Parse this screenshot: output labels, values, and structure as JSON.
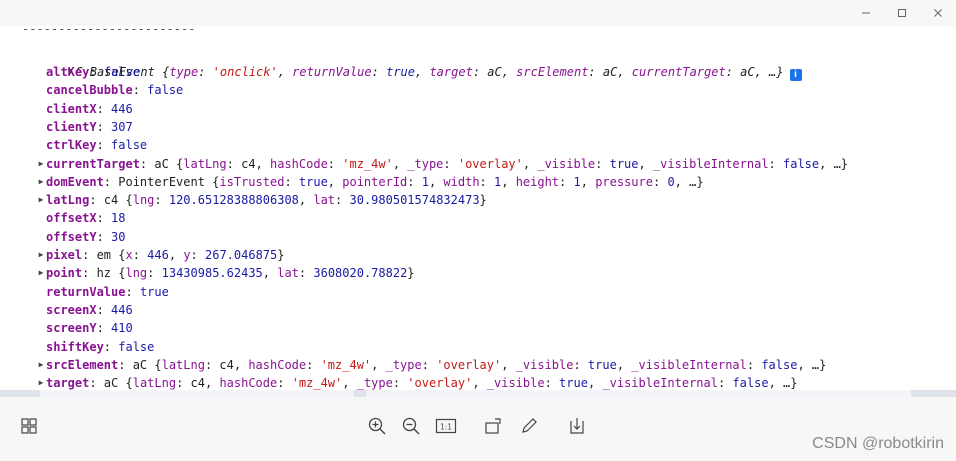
{
  "window": {
    "controls": {
      "minimize": "—",
      "maximize": "□",
      "close": "✕"
    }
  },
  "console": {
    "separator": "------------------------",
    "header": {
      "class_name": "C.BaseEvent",
      "summary_parts": [
        {
          "t": "{",
          "c": "punc"
        },
        {
          "t": "type",
          "c": "knb"
        },
        {
          "t": ": ",
          "c": "punc"
        },
        {
          "t": "'onclick'",
          "c": "str"
        },
        {
          "t": ", ",
          "c": "punc"
        },
        {
          "t": "returnValue",
          "c": "knb"
        },
        {
          "t": ": ",
          "c": "punc"
        },
        {
          "t": "true",
          "c": "bool"
        },
        {
          "t": ", ",
          "c": "punc"
        },
        {
          "t": "target",
          "c": "knb"
        },
        {
          "t": ": aC, ",
          "c": "punc"
        },
        {
          "t": "srcElement",
          "c": "knb"
        },
        {
          "t": ": aC, ",
          "c": "punc"
        },
        {
          "t": "currentTarget",
          "c": "knb"
        },
        {
          "t": ": aC, …}",
          "c": "punc"
        }
      ],
      "info_icon": "i"
    },
    "properties": [
      {
        "key": "altKey",
        "expandable": false,
        "parts": [
          {
            "t": "false",
            "c": "bool"
          }
        ]
      },
      {
        "key": "cancelBubble",
        "expandable": false,
        "parts": [
          {
            "t": "false",
            "c": "bool"
          }
        ]
      },
      {
        "key": "clientX",
        "expandable": false,
        "parts": [
          {
            "t": "446",
            "c": "num"
          }
        ]
      },
      {
        "key": "clientY",
        "expandable": false,
        "parts": [
          {
            "t": "307",
            "c": "num"
          }
        ]
      },
      {
        "key": "ctrlKey",
        "expandable": false,
        "parts": [
          {
            "t": "false",
            "c": "bool"
          }
        ]
      },
      {
        "key": "currentTarget",
        "expandable": true,
        "parts": [
          {
            "t": "aC {",
            "c": "obj"
          },
          {
            "t": "latLng",
            "c": "knb"
          },
          {
            "t": ": c4, ",
            "c": "obj"
          },
          {
            "t": "hashCode",
            "c": "knb"
          },
          {
            "t": ": ",
            "c": "obj"
          },
          {
            "t": "'mz_4w'",
            "c": "str"
          },
          {
            "t": ", ",
            "c": "obj"
          },
          {
            "t": "_type",
            "c": "knb"
          },
          {
            "t": ": ",
            "c": "obj"
          },
          {
            "t": "'overlay'",
            "c": "str"
          },
          {
            "t": ", ",
            "c": "obj"
          },
          {
            "t": "_visible",
            "c": "knb"
          },
          {
            "t": ": ",
            "c": "obj"
          },
          {
            "t": "true",
            "c": "bool"
          },
          {
            "t": ", ",
            "c": "obj"
          },
          {
            "t": "_visibleInternal",
            "c": "knb"
          },
          {
            "t": ": ",
            "c": "obj"
          },
          {
            "t": "false",
            "c": "bool"
          },
          {
            "t": ", …}",
            "c": "obj"
          }
        ]
      },
      {
        "key": "domEvent",
        "expandable": true,
        "parts": [
          {
            "t": "PointerEvent {",
            "c": "obj"
          },
          {
            "t": "isTrusted",
            "c": "knb"
          },
          {
            "t": ": ",
            "c": "obj"
          },
          {
            "t": "true",
            "c": "bool"
          },
          {
            "t": ", ",
            "c": "obj"
          },
          {
            "t": "pointerId",
            "c": "knb"
          },
          {
            "t": ": ",
            "c": "obj"
          },
          {
            "t": "1",
            "c": "num"
          },
          {
            "t": ", ",
            "c": "obj"
          },
          {
            "t": "width",
            "c": "knb"
          },
          {
            "t": ": ",
            "c": "obj"
          },
          {
            "t": "1",
            "c": "num"
          },
          {
            "t": ", ",
            "c": "obj"
          },
          {
            "t": "height",
            "c": "knb"
          },
          {
            "t": ": ",
            "c": "obj"
          },
          {
            "t": "1",
            "c": "num"
          },
          {
            "t": ", ",
            "c": "obj"
          },
          {
            "t": "pressure",
            "c": "knb"
          },
          {
            "t": ": ",
            "c": "obj"
          },
          {
            "t": "0",
            "c": "num"
          },
          {
            "t": ", …}",
            "c": "obj"
          }
        ]
      },
      {
        "key": "latLng",
        "expandable": true,
        "parts": [
          {
            "t": "c4 {",
            "c": "obj"
          },
          {
            "t": "lng",
            "c": "knb"
          },
          {
            "t": ": ",
            "c": "obj"
          },
          {
            "t": "120.65128388806308",
            "c": "num"
          },
          {
            "t": ", ",
            "c": "obj"
          },
          {
            "t": "lat",
            "c": "knb"
          },
          {
            "t": ": ",
            "c": "obj"
          },
          {
            "t": "30.980501574832473",
            "c": "num"
          },
          {
            "t": "}",
            "c": "obj"
          }
        ]
      },
      {
        "key": "offsetX",
        "expandable": false,
        "parts": [
          {
            "t": "18",
            "c": "num"
          }
        ]
      },
      {
        "key": "offsetY",
        "expandable": false,
        "parts": [
          {
            "t": "30",
            "c": "num"
          }
        ]
      },
      {
        "key": "pixel",
        "expandable": true,
        "parts": [
          {
            "t": "em {",
            "c": "obj"
          },
          {
            "t": "x",
            "c": "knb"
          },
          {
            "t": ": ",
            "c": "obj"
          },
          {
            "t": "446",
            "c": "num"
          },
          {
            "t": ", ",
            "c": "obj"
          },
          {
            "t": "y",
            "c": "knb"
          },
          {
            "t": ": ",
            "c": "obj"
          },
          {
            "t": "267.046875",
            "c": "num"
          },
          {
            "t": "}",
            "c": "obj"
          }
        ]
      },
      {
        "key": "point",
        "expandable": true,
        "parts": [
          {
            "t": "hz {",
            "c": "obj"
          },
          {
            "t": "lng",
            "c": "knb"
          },
          {
            "t": ": ",
            "c": "obj"
          },
          {
            "t": "13430985.62435",
            "c": "num"
          },
          {
            "t": ", ",
            "c": "obj"
          },
          {
            "t": "lat",
            "c": "knb"
          },
          {
            "t": ": ",
            "c": "obj"
          },
          {
            "t": "3608020.78822",
            "c": "num"
          },
          {
            "t": "}",
            "c": "obj"
          }
        ]
      },
      {
        "key": "returnValue",
        "expandable": false,
        "parts": [
          {
            "t": "true",
            "c": "bool"
          }
        ]
      },
      {
        "key": "screenX",
        "expandable": false,
        "parts": [
          {
            "t": "446",
            "c": "num"
          }
        ]
      },
      {
        "key": "screenY",
        "expandable": false,
        "parts": [
          {
            "t": "410",
            "c": "num"
          }
        ]
      },
      {
        "key": "shiftKey",
        "expandable": false,
        "parts": [
          {
            "t": "false",
            "c": "bool"
          }
        ]
      },
      {
        "key": "srcElement",
        "expandable": true,
        "parts": [
          {
            "t": "aC {",
            "c": "obj"
          },
          {
            "t": "latLng",
            "c": "knb"
          },
          {
            "t": ": c4, ",
            "c": "obj"
          },
          {
            "t": "hashCode",
            "c": "knb"
          },
          {
            "t": ": ",
            "c": "obj"
          },
          {
            "t": "'mz_4w'",
            "c": "str"
          },
          {
            "t": ", ",
            "c": "obj"
          },
          {
            "t": "_type",
            "c": "knb"
          },
          {
            "t": ": ",
            "c": "obj"
          },
          {
            "t": "'overlay'",
            "c": "str"
          },
          {
            "t": ", ",
            "c": "obj"
          },
          {
            "t": "_visible",
            "c": "knb"
          },
          {
            "t": ": ",
            "c": "obj"
          },
          {
            "t": "true",
            "c": "bool"
          },
          {
            "t": ", ",
            "c": "obj"
          },
          {
            "t": "_visibleInternal",
            "c": "knb"
          },
          {
            "t": ": ",
            "c": "obj"
          },
          {
            "t": "false",
            "c": "bool"
          },
          {
            "t": ", …}",
            "c": "obj"
          }
        ]
      },
      {
        "key": "target",
        "expandable": true,
        "parts": [
          {
            "t": "aC {",
            "c": "obj"
          },
          {
            "t": "latLng",
            "c": "knb"
          },
          {
            "t": ": c4, ",
            "c": "obj"
          },
          {
            "t": "hashCode",
            "c": "knb"
          },
          {
            "t": ": ",
            "c": "obj"
          },
          {
            "t": "'mz_4w'",
            "c": "str"
          },
          {
            "t": ", ",
            "c": "obj"
          },
          {
            "t": "_type",
            "c": "knb"
          },
          {
            "t": ": ",
            "c": "obj"
          },
          {
            "t": "'overlay'",
            "c": "str"
          },
          {
            "t": ", ",
            "c": "obj"
          },
          {
            "t": "_visible",
            "c": "knb"
          },
          {
            "t": ": ",
            "c": "obj"
          },
          {
            "t": "true",
            "c": "bool"
          },
          {
            "t": ", ",
            "c": "obj"
          },
          {
            "t": "_visibleInternal",
            "c": "knb"
          },
          {
            "t": ": ",
            "c": "obj"
          },
          {
            "t": "false",
            "c": "bool"
          },
          {
            "t": ", …}",
            "c": "obj"
          }
        ]
      }
    ]
  },
  "toolbar": {
    "icons": [
      "grid-icon",
      "zoom-in-icon",
      "zoom-out-icon",
      "actual-size-icon",
      "rotate-icon",
      "edit-icon",
      "download-icon"
    ],
    "actual_size_label": "1:1",
    "watermark": "CSDN @robotkirin"
  },
  "colors": {
    "key": "#881391",
    "number": "#1a1aa6",
    "string": "#c41a16",
    "info": "#1a73e8"
  }
}
